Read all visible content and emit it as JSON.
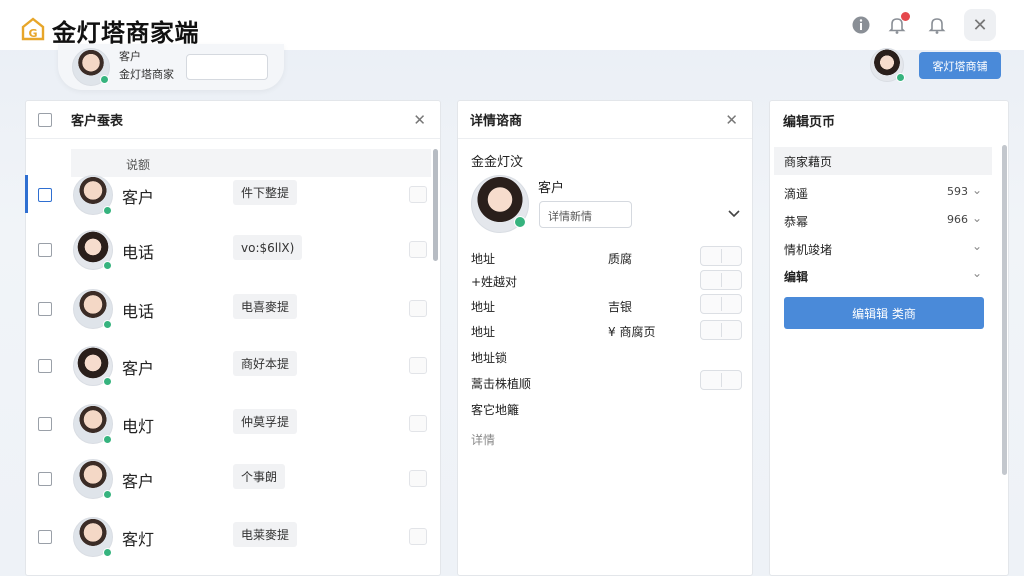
{
  "app": {
    "title": "金灯塔商家端"
  },
  "header": {
    "customer_name": "客户",
    "customer_sub": "金灯塔商家",
    "top_button": "客灯塔商铺"
  },
  "customer_list": {
    "title": "客户蚕表",
    "subheader": "说额",
    "rows": [
      {
        "name": "客户",
        "tag": "件下整提",
        "avatar": "m"
      },
      {
        "name": "电话",
        "tag": "vo:$6llX)",
        "avatar": "f"
      },
      {
        "name": "电话",
        "tag": "电喜麥提",
        "avatar": "m"
      },
      {
        "name": "客户",
        "tag": "商好本提",
        "avatar": "f"
      },
      {
        "name": "电灯",
        "tag": "仲莫孚提",
        "avatar": "m"
      },
      {
        "name": "客户",
        "tag": "个事朗",
        "avatar": "m"
      },
      {
        "name": "客灯",
        "tag": "电莱麥提",
        "avatar": "m"
      }
    ]
  },
  "details": {
    "title": "详情谘商",
    "section_label": "金金灯汶",
    "customer_label": "客户",
    "input_value": "详情新情",
    "fields": [
      {
        "label": "地址",
        "value": "质腐"
      },
      {
        "label": "+姓越对",
        "value": ""
      },
      {
        "label": "地址",
        "value": "吉银"
      },
      {
        "label": "地址",
        "value": "¥ 商腐页"
      },
      {
        "label": "地址锁",
        "value": ""
      },
      {
        "label": "蒿击株植顺",
        "value": ""
      },
      {
        "label": "客它地籬",
        "value": ""
      }
    ],
    "footer": "详情"
  },
  "edit": {
    "title": "编辑页币",
    "section": "商家藉页",
    "rows": [
      {
        "label": "滴遥",
        "value": "593"
      },
      {
        "label": "恭幂",
        "value": "966"
      },
      {
        "label": "情机竣堵",
        "value": ""
      },
      {
        "label": "编辑",
        "value": ""
      }
    ],
    "button": "编辑辑 类商"
  }
}
